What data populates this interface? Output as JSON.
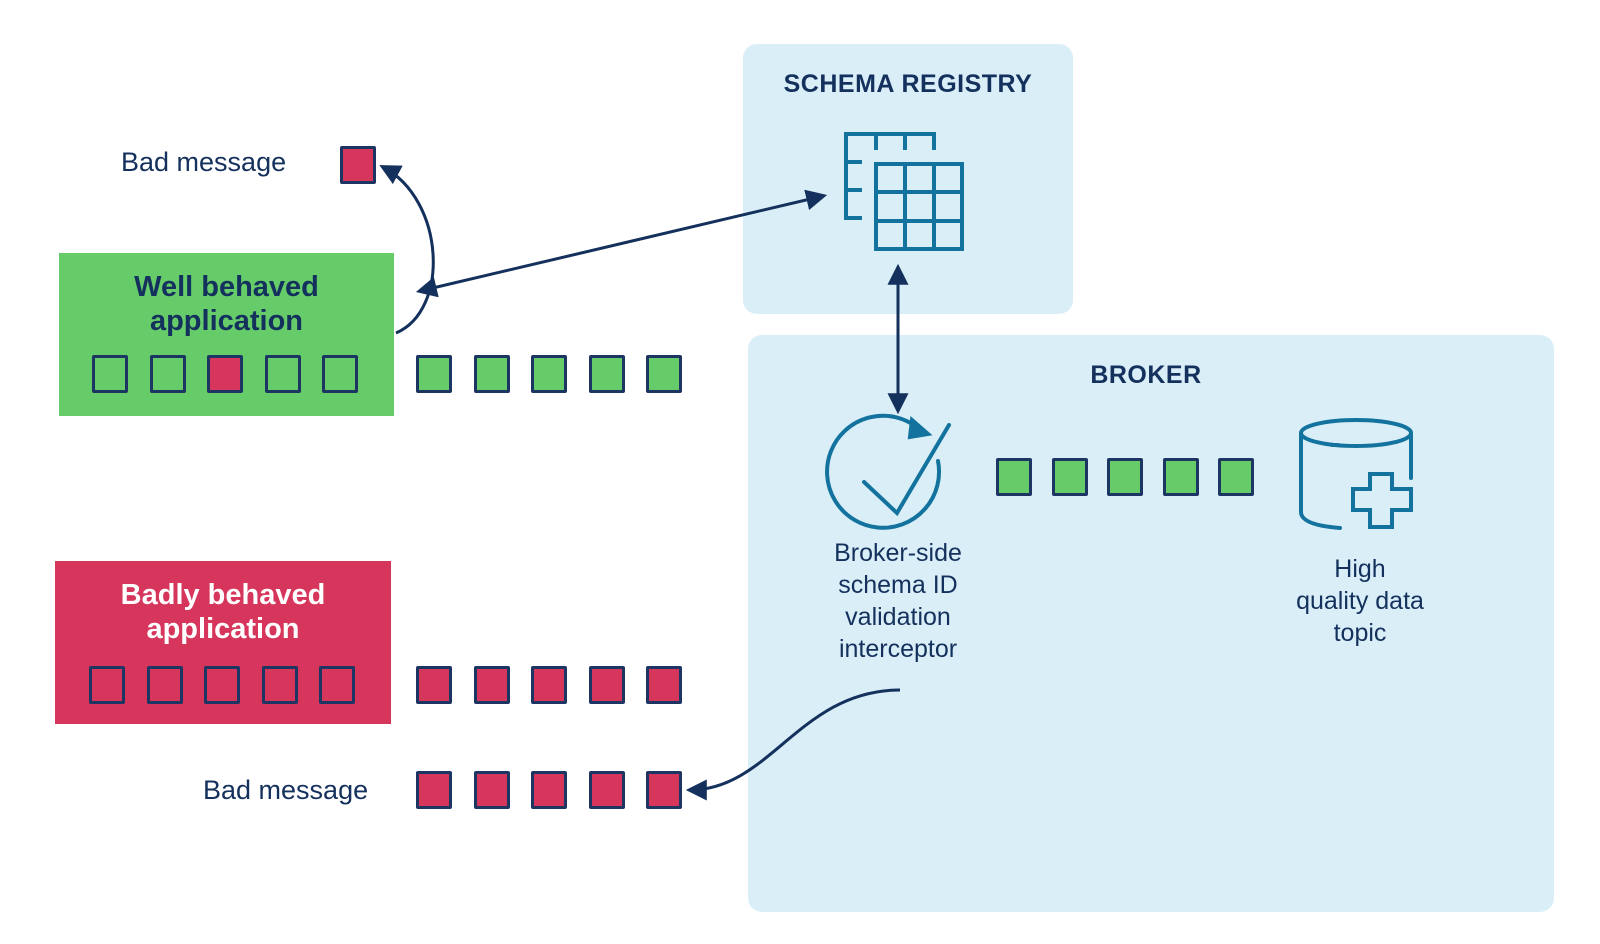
{
  "diagram": {
    "schema_registry": {
      "title": "SCHEMA REGISTRY",
      "icon": "table-schema-icon"
    },
    "broker": {
      "title": "BROKER",
      "interceptor": {
        "icon": "check-cycle-icon",
        "caption": [
          "Broker-side",
          "schema ID",
          "validation",
          "interceptor"
        ]
      },
      "topic": {
        "icon": "database-plus-icon",
        "caption": [
          "High",
          "quality data",
          "topic"
        ]
      },
      "message_queue": [
        "green",
        "green",
        "green",
        "green",
        "green"
      ]
    },
    "well_behaved_app": {
      "title_line1": "Well behaved",
      "title_line2": "application",
      "buffer": [
        "empty",
        "empty",
        "red",
        "empty",
        "empty"
      ],
      "outgoing": [
        "green",
        "green",
        "green",
        "green",
        "green"
      ]
    },
    "badly_behaved_app": {
      "title_line1": "Badly behaved",
      "title_line2": "application",
      "buffer": [
        "empty",
        "empty",
        "empty",
        "empty",
        "empty"
      ],
      "outgoing": [
        "red",
        "red",
        "red",
        "red",
        "red"
      ]
    },
    "bad_message_top": {
      "label": "Bad message",
      "messages": [
        "red"
      ]
    },
    "bad_message_bottom": {
      "label": "Bad message",
      "messages": [
        "red",
        "red",
        "red",
        "red",
        "red"
      ]
    },
    "colors": {
      "green": "#66cc6a",
      "red": "#d6355c",
      "navy": "#14305c",
      "panel": "#d9eef7",
      "icon": "#13739e"
    }
  }
}
